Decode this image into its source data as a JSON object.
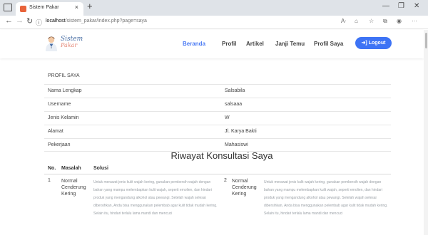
{
  "browser": {
    "tab_title": "Sistem Pakar",
    "close_glyph": "×",
    "newtab_glyph": "+",
    "url_host": "localhost",
    "url_path": "/sistem_pakar/index.php?page=saya",
    "icons": [
      "back-arrow-icon",
      "forward-arrow-icon",
      "refresh-icon",
      "info-icon",
      "read-aloud-icon",
      "tracking-icon",
      "favorites-icon",
      "collections-icon",
      "profile-icon",
      "more-icon"
    ]
  },
  "site": {
    "logo_name": "Sistem",
    "logo_sub": "Pakar",
    "menu": [
      "Beranda",
      "Profil",
      "Artikel",
      "Janji Temu",
      "Profil Saya"
    ],
    "logout": "Logout",
    "accent": "#3d73f5"
  },
  "profile": {
    "heading": "PROFIL SAYA",
    "rows": [
      {
        "label": "Nama Lengkap",
        "value": "Salsabila"
      },
      {
        "label": "Username",
        "value": "salsaaa"
      },
      {
        "label": "Jenis Kelamin",
        "value": "W"
      },
      {
        "label": "Alamat",
        "value": "Jl. Karya Bakti"
      },
      {
        "label": "Pekerjaan",
        "value": "Mahasiswi"
      }
    ]
  },
  "history": {
    "title": "Riwayat Konsultasi Saya",
    "headers": {
      "no": "No.",
      "masalah": "Masalah",
      "solusi": "Solusi"
    },
    "entries": [
      {
        "no": "1",
        "masalah": "Normal Cenderung Kering",
        "solusi": "Untuk merawat jenis kulit wajah kering, gunakan pembersih wajah dengan bahan yang mampu melembapkan kulit wajah, seperti emolien, dan hindari produk yang mengandung alkohol atau pewangi. Setelah wajah selesai dibersihkan, Anda bisa menggunakan pelembab agar kulit tidak mudah kering. Selain itu, hindari terlalu lama mandi dan mencuci"
      },
      {
        "no": "2",
        "masalah": "Normal Cenderung Kering",
        "solusi": "Untuk merawat jenis kulit wajah kering, gunakan pembersih wajah dengan bahan yang mampu melembapkan kulit wajah, seperti emolien, dan hindari produk yang mengandung alkohol atau pewangi. Setelah wajah selesai dibersihkan, Anda bisa menggunakan pelembab agar kulit tidak mudah kering. Selain itu, hindari terlalu lama mandi dan mencuci"
      }
    ]
  }
}
